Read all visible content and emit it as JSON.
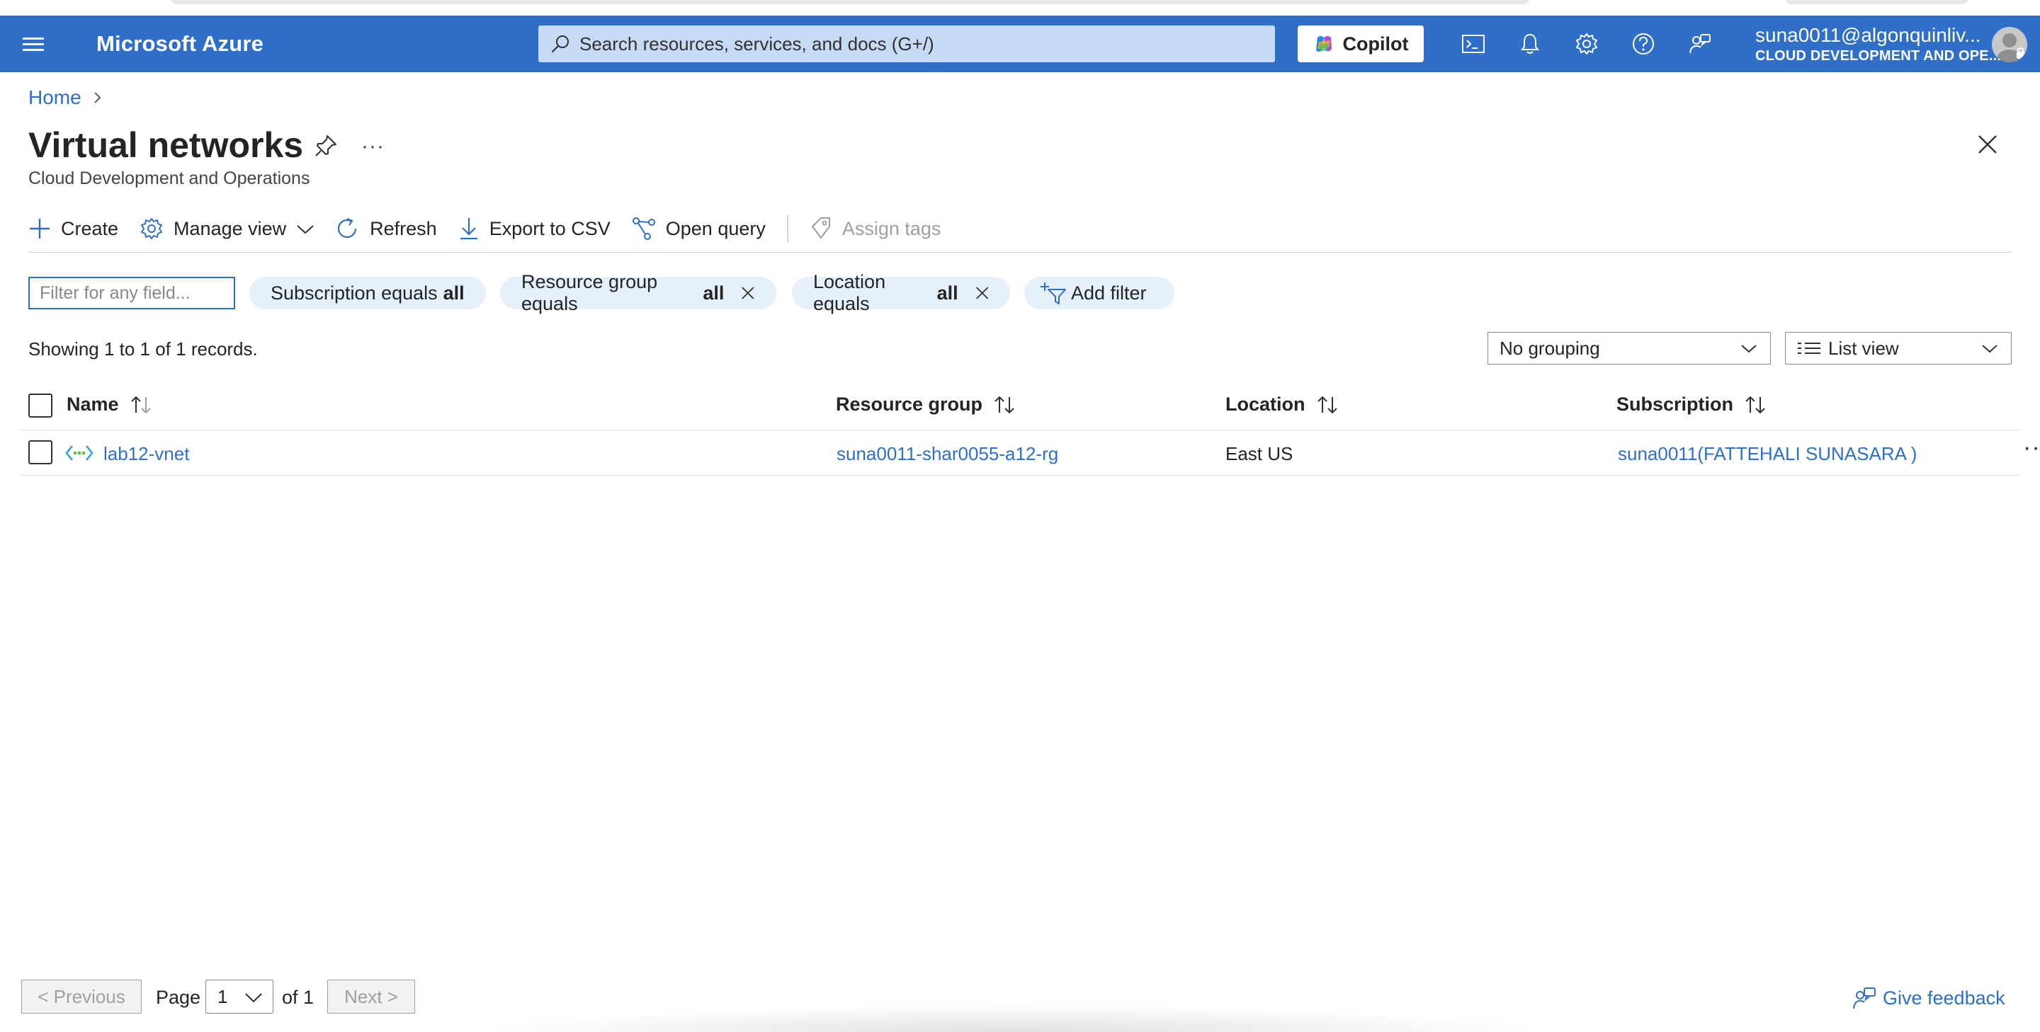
{
  "header": {
    "brand": "Microsoft Azure",
    "search_placeholder": "Search resources, services, and docs (G+/)",
    "copilot_label": "Copilot",
    "account_email": "suna0011@algonquinliv...",
    "account_tenant": "CLOUD DEVELOPMENT AND OPE...",
    "accent_color": "#2f6fc8"
  },
  "breadcrumb": {
    "home": "Home"
  },
  "page": {
    "title": "Virtual networks",
    "more": "···",
    "subtitle": "Cloud Development and Operations"
  },
  "toolbar": {
    "create": "Create",
    "manage_view": "Manage view",
    "refresh": "Refresh",
    "export_csv": "Export to CSV",
    "open_query": "Open query",
    "assign_tags": "Assign tags"
  },
  "filters": {
    "placeholder": "Filter for any field...",
    "subscription_label": "Subscription equals",
    "subscription_value": "all",
    "resource_group_label": "Resource group equals",
    "resource_group_value": "all",
    "location_label": "Location equals",
    "location_value": "all",
    "add_filter": "Add filter"
  },
  "records_text": "Showing 1 to 1 of 1 records.",
  "grouping_selected": "No grouping",
  "view_selected": "List view",
  "table": {
    "columns": {
      "name": "Name",
      "resource_group": "Resource group",
      "location": "Location",
      "subscription": "Subscription"
    },
    "rows": [
      {
        "name": "lab12-vnet",
        "resource_group": "suna0011-shar0055-a12-rg",
        "location": "East US",
        "subscription": "suna0011(FATTEHALI SUNASARA )",
        "more": "···"
      }
    ]
  },
  "pagination": {
    "previous": "< Previous",
    "page_label": "Page",
    "current_page": "1",
    "of_label": "of 1",
    "next": "Next >"
  },
  "feedback": "Give feedback"
}
